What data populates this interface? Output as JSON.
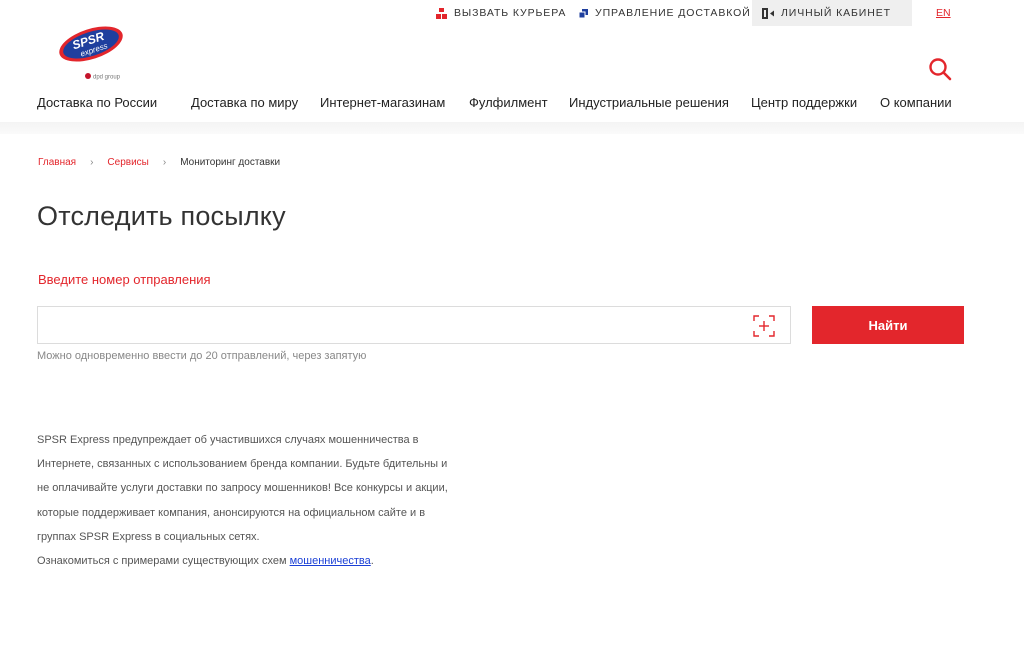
{
  "topbar": {
    "courier_label": "Вызвать курьера",
    "manage_label": "Управление доставкой",
    "cabinet_label": "Личный кабинет",
    "lang_label": "EN"
  },
  "logo": {
    "brand_text_top": "SPSR",
    "brand_text_bottom": "express",
    "sub_text": "dpd group"
  },
  "nav": {
    "items": [
      "Доставка по России",
      "Доставка по миру",
      "Интернет-магазинам",
      "Фулфилмент",
      "Индустриальные решения",
      "Центр поддержки",
      "О компании"
    ]
  },
  "breadcrumb": {
    "home": "Главная",
    "services": "Сервисы",
    "current": "Мониторинг доставки",
    "separator": "›"
  },
  "main": {
    "title": "Отследить посылку",
    "input_label": "Введите номер отправления",
    "input_value": "",
    "find_button": "Найти",
    "hint": "Можно одновременно ввести до 20 отправлений, через запятую"
  },
  "warning": {
    "lines": [
      "SPSR Express предупреждает об участившихся случаях мошенничества в",
      "Интернете, связанных с использованием бренда компании. Будьте бдительны и",
      "не оплачивайте услуги доставки по запросу мошенников! Все конкурсы и акции,",
      "которые поддерживает компания, анонсируются на официальном сайте и в",
      "группах SPSR Express в социальных сетях."
    ],
    "examples_prefix": "Ознакомиться с примерами существующих схем ",
    "examples_link": "мошенничества",
    "examples_suffix": "."
  },
  "colors": {
    "brand_red": "#e3262c",
    "logo_blue": "#1f3f9e",
    "link_blue": "#1a3fd6"
  },
  "icons": {
    "courier": "courier-boxes-icon",
    "manage": "manage-delivery-icon",
    "cabinet": "login-door-icon",
    "search": "search-icon",
    "scan": "barcode-scan-icon"
  }
}
